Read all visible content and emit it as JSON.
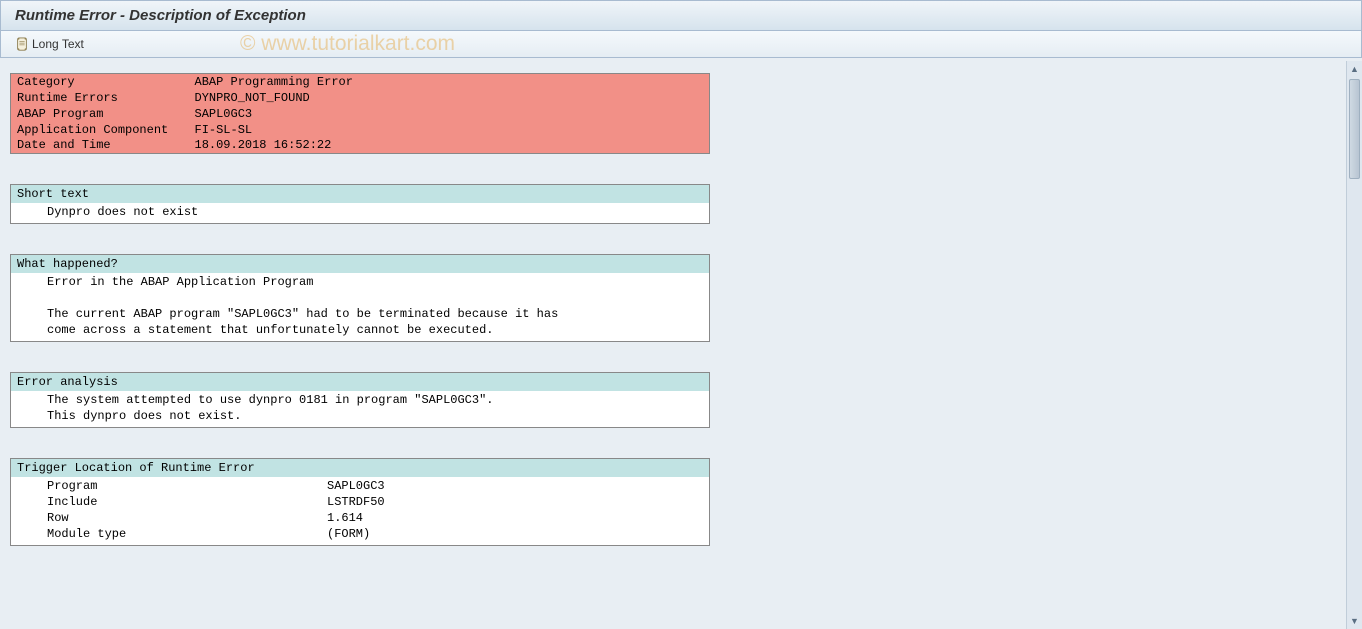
{
  "title": "Runtime Error - Description of Exception",
  "toolbar": {
    "long_text": "Long Text"
  },
  "header": {
    "rows": [
      {
        "label": "Category",
        "value": "ABAP Programming Error"
      },
      {
        "label": "Runtime Errors",
        "value": "DYNPRO_NOT_FOUND"
      },
      {
        "label": "ABAP Program",
        "value": "SAPL0GC3"
      },
      {
        "label": "Application Component",
        "value": "FI-SL-SL"
      },
      {
        "label": "Date and Time",
        "value": "18.09.2018 16:52:22"
      }
    ]
  },
  "sections": {
    "short_text": {
      "title": "Short text",
      "lines": [
        "Dynpro does not exist"
      ]
    },
    "what_happened": {
      "title": "What happened?",
      "lines": [
        "Error in the ABAP Application Program",
        "",
        "The current ABAP program \"SAPL0GC3\" had to be terminated because it has",
        "come across a statement that unfortunately cannot be executed."
      ]
    },
    "error_analysis": {
      "title": "Error analysis",
      "lines": [
        "The system attempted to use dynpro 0181 in program \"SAPL0GC3\".",
        "This dynpro does not exist."
      ]
    },
    "trigger_location": {
      "title": "Trigger Location of Runtime Error",
      "rows": [
        {
          "label": "Program",
          "value": "SAPL0GC3"
        },
        {
          "label": "Include",
          "value": "LSTRDF50"
        },
        {
          "label": "Row",
          "value": "1.614"
        },
        {
          "label": "Module type",
          "value": "(FORM)"
        }
      ]
    }
  },
  "watermark": "© www.tutorialkart.com"
}
